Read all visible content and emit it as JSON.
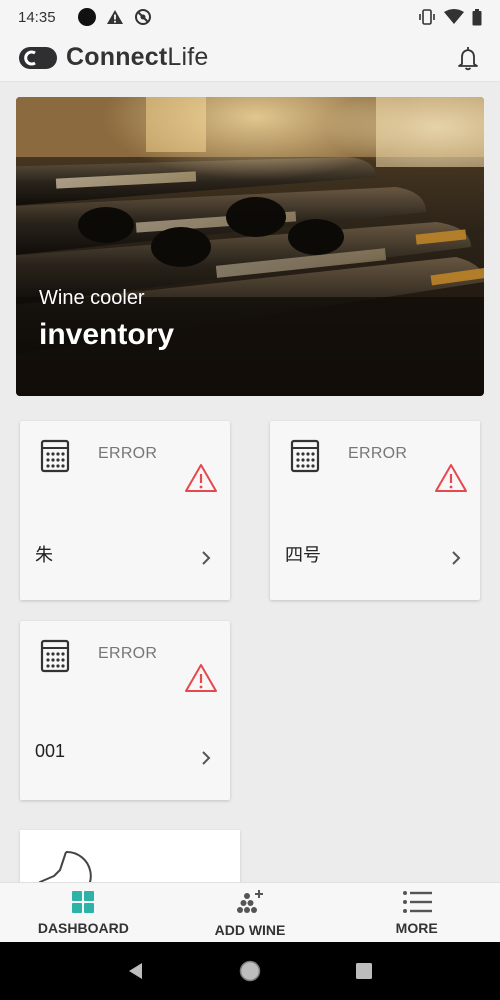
{
  "status_bar": {
    "time": "14:35"
  },
  "header": {
    "brand_bold": "Connect",
    "brand_light": "Life"
  },
  "hero": {
    "subtitle": "Wine cooler",
    "title": "inventory"
  },
  "devices": [
    {
      "status": "ERROR",
      "name": "朱"
    },
    {
      "status": "ERROR",
      "name": "四号"
    },
    {
      "status": "ERROR",
      "name": "001"
    }
  ],
  "bottom_nav": {
    "dashboard": "DASHBOARD",
    "add_wine": "ADD WINE",
    "more": "MORE"
  },
  "colors": {
    "accent": "#2bb3a8",
    "error": "#e5484d"
  }
}
